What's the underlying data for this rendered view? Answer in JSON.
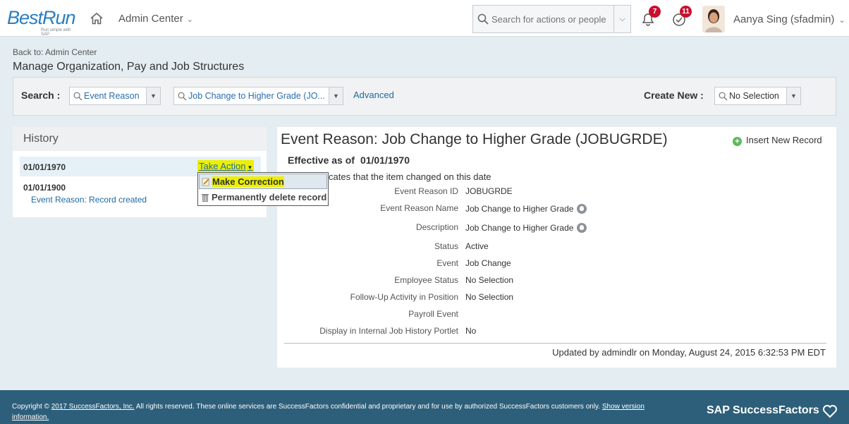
{
  "header": {
    "logo_text": "BestRun",
    "logo_tagline": "Run simple with SAP",
    "nav_label": "Admin Center",
    "search_placeholder": "Search for actions or people",
    "notifications_count": "7",
    "todo_count": "11",
    "user_name": "Aanya Sing (sfadmin)"
  },
  "breadcrumb": {
    "back_link": "Back to: Admin Center",
    "page_title": "Manage Organization, Pay and Job Structures"
  },
  "search_panel": {
    "search_label": "Search :",
    "type_value": "Event Reason",
    "record_value": "Job Change to Higher Grade (JO...",
    "advanced_link": "Advanced",
    "create_label": "Create New :",
    "create_value": "No Selection"
  },
  "history": {
    "title": "History",
    "entries": [
      {
        "date": "01/01/1970",
        "action": "Take Action"
      },
      {
        "date": "01/01/1900",
        "note": "Event Reason: Record created"
      }
    ],
    "menu": [
      {
        "label": "Make Correction"
      },
      {
        "label": "Permanently delete record"
      }
    ]
  },
  "detail": {
    "title": "Event Reason: Job Change to Higher Grade (JOBUGRDE)",
    "insert_label": "Insert New Record",
    "effective_label": "Effective as of",
    "effective_date": "01/01/1970",
    "indicates_text": "cates that the item changed on this date",
    "fields": [
      {
        "label": "Event Reason ID",
        "value": "JOBUGRDE"
      },
      {
        "label": "Event Reason Name",
        "value": "Job Change to Higher Grade"
      },
      {
        "label": "Description",
        "value": "Job Change to Higher Grade"
      },
      {
        "label": "Status",
        "value": "Active"
      },
      {
        "label": "Event",
        "value": "Job Change"
      },
      {
        "label": "Employee Status",
        "value": "No Selection"
      },
      {
        "label": "Follow-Up Activity in Position",
        "value": "No Selection"
      },
      {
        "label": "Payroll Event",
        "value": ""
      },
      {
        "label": "Display in Internal Job History Portlet",
        "value": "No"
      }
    ],
    "updated_text": "Updated by admindlr on Monday, August 24, 2015 6:32:53 PM EDT"
  },
  "footer": {
    "copyright_prefix": "Copyright ©",
    "copyright_link": "2017 SuccessFactors, Inc.",
    "copyright_body": " All rights reserved. These online services are SuccessFactors confidential and proprietary and for use by authorized SuccessFactors customers only. ",
    "show_version_link": "Show version information.",
    "brand": "SAP SuccessFactors"
  },
  "colors": {
    "accent": "#1c6aa6",
    "highlight": "#ecf000",
    "footer_bg": "#2d5f7a",
    "badge": "#c8102e"
  }
}
